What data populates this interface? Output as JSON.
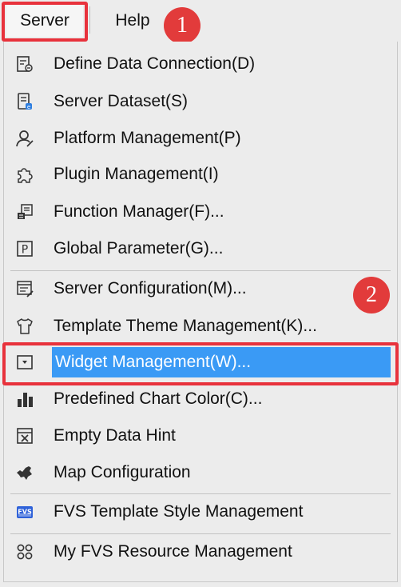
{
  "menubar": {
    "server_label": "Server",
    "help_label": "Help"
  },
  "annotations": {
    "badge_1": "1",
    "badge_2": "2"
  },
  "menu": {
    "items": [
      {
        "label": "Define Data Connection(D)",
        "icon": "data-connection-icon"
      },
      {
        "label": "Server Dataset(S)",
        "icon": "server-dataset-icon"
      },
      {
        "label": "Platform Management(P)",
        "icon": "user-icon"
      },
      {
        "label": "Plugin Management(I)",
        "icon": "puzzle-icon"
      },
      {
        "label": "Function Manager(F)...",
        "icon": "function-icon"
      },
      {
        "label": "Global Parameter(G)...",
        "icon": "parameter-p-icon"
      },
      {
        "label": "Server Configuration(M)...",
        "icon": "configuration-icon"
      },
      {
        "label": "Template Theme Management(K)...",
        "icon": "shirt-icon"
      },
      {
        "label": "Widget Management(W)...",
        "icon": "widget-dropdown-icon",
        "selected": true
      },
      {
        "label": "Predefined Chart Color(C)...",
        "icon": "bar-chart-icon"
      },
      {
        "label": "Empty Data Hint",
        "icon": "empty-data-icon"
      },
      {
        "label": "Map Configuration",
        "icon": "map-icon"
      },
      {
        "label": "FVS Template Style Management",
        "icon": "fvs-icon"
      },
      {
        "label": "My FVS Resource Management",
        "icon": "resource-grid-icon"
      }
    ]
  },
  "colors": {
    "selection": "#3a9af5",
    "annotation_red": "#e23b3b"
  }
}
